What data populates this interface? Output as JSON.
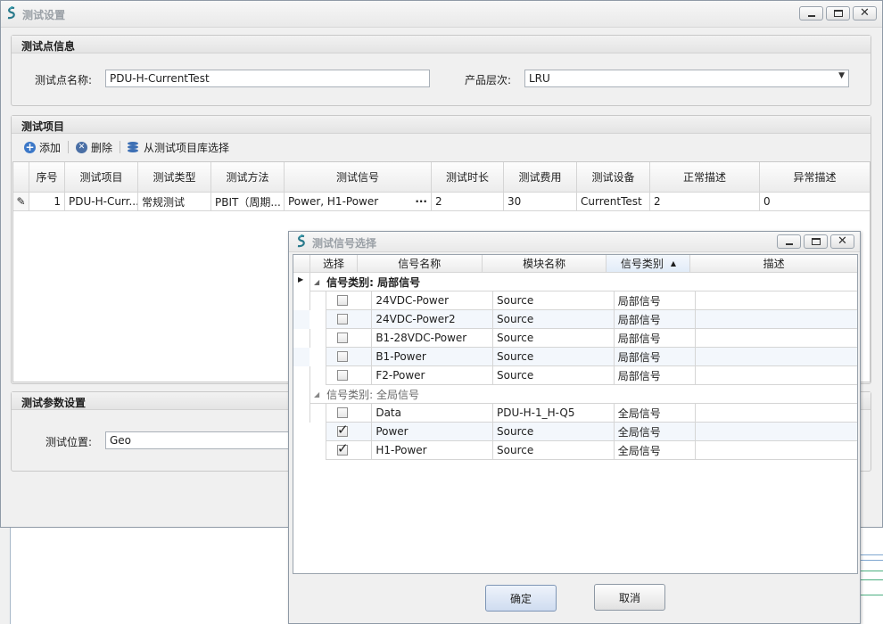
{
  "main_window": {
    "title": "测试设置",
    "test_point": {
      "header": "测试点信息",
      "name_label": "测试点名称:",
      "name_value": "PDU-H-CurrentTest",
      "level_label": "产品层次:",
      "level_value": "LRU"
    },
    "test_items": {
      "header": "测试项目",
      "toolbar": {
        "add": "添加",
        "delete": "删除",
        "from_library": "从测试项目库选择"
      },
      "columns": [
        "序号",
        "测试项目",
        "测试类型",
        "测试方法",
        "测试信号",
        "测试时长",
        "测试费用",
        "测试设备",
        "正常描述",
        "异常描述"
      ],
      "rows": [
        {
          "no": "1",
          "item": "PDU-H-Curr...",
          "type": "常规测试",
          "method": "PBIT（周期...",
          "signal": "Power, H1-Power",
          "duration": "2",
          "cost": "30",
          "device": "CurrentTest",
          "normal": "2",
          "abnormal": "0"
        }
      ]
    },
    "params": {
      "header": "测试参数设置",
      "location_label": "测试位置:",
      "location_value": "Geo"
    }
  },
  "dialog": {
    "title": "测试信号选择",
    "columns": [
      "选择",
      "信号名称",
      "模块名称",
      "信号类别",
      "描述"
    ],
    "groups": [
      {
        "label": "信号类别: 局部信号",
        "rows": [
          {
            "checked": false,
            "name": "24VDC-Power",
            "module": "Source",
            "category": "局部信号",
            "desc": ""
          },
          {
            "checked": false,
            "name": "24VDC-Power2",
            "module": "Source",
            "category": "局部信号",
            "desc": ""
          },
          {
            "checked": false,
            "name": "B1-28VDC-Power",
            "module": "Source",
            "category": "局部信号",
            "desc": ""
          },
          {
            "checked": false,
            "name": "B1-Power",
            "module": "Source",
            "category": "局部信号",
            "desc": ""
          },
          {
            "checked": false,
            "name": "F2-Power",
            "module": "Source",
            "category": "局部信号",
            "desc": ""
          }
        ]
      },
      {
        "label": "信号类别: 全局信号",
        "rows": [
          {
            "checked": false,
            "name": "Data",
            "module": "PDU-H-1_H-Q5",
            "category": "全局信号",
            "desc": ""
          },
          {
            "checked": true,
            "name": "Power",
            "module": "Source",
            "category": "全局信号",
            "desc": ""
          },
          {
            "checked": true,
            "name": "H1-Power",
            "module": "Source",
            "category": "全局信号",
            "desc": ""
          }
        ]
      }
    ],
    "ok_label": "确定",
    "cancel_label": "取消"
  },
  "colors": {
    "accent": "#3c78c8",
    "row_alt": "#f3f7fc",
    "selected_header": "#e6effa"
  }
}
